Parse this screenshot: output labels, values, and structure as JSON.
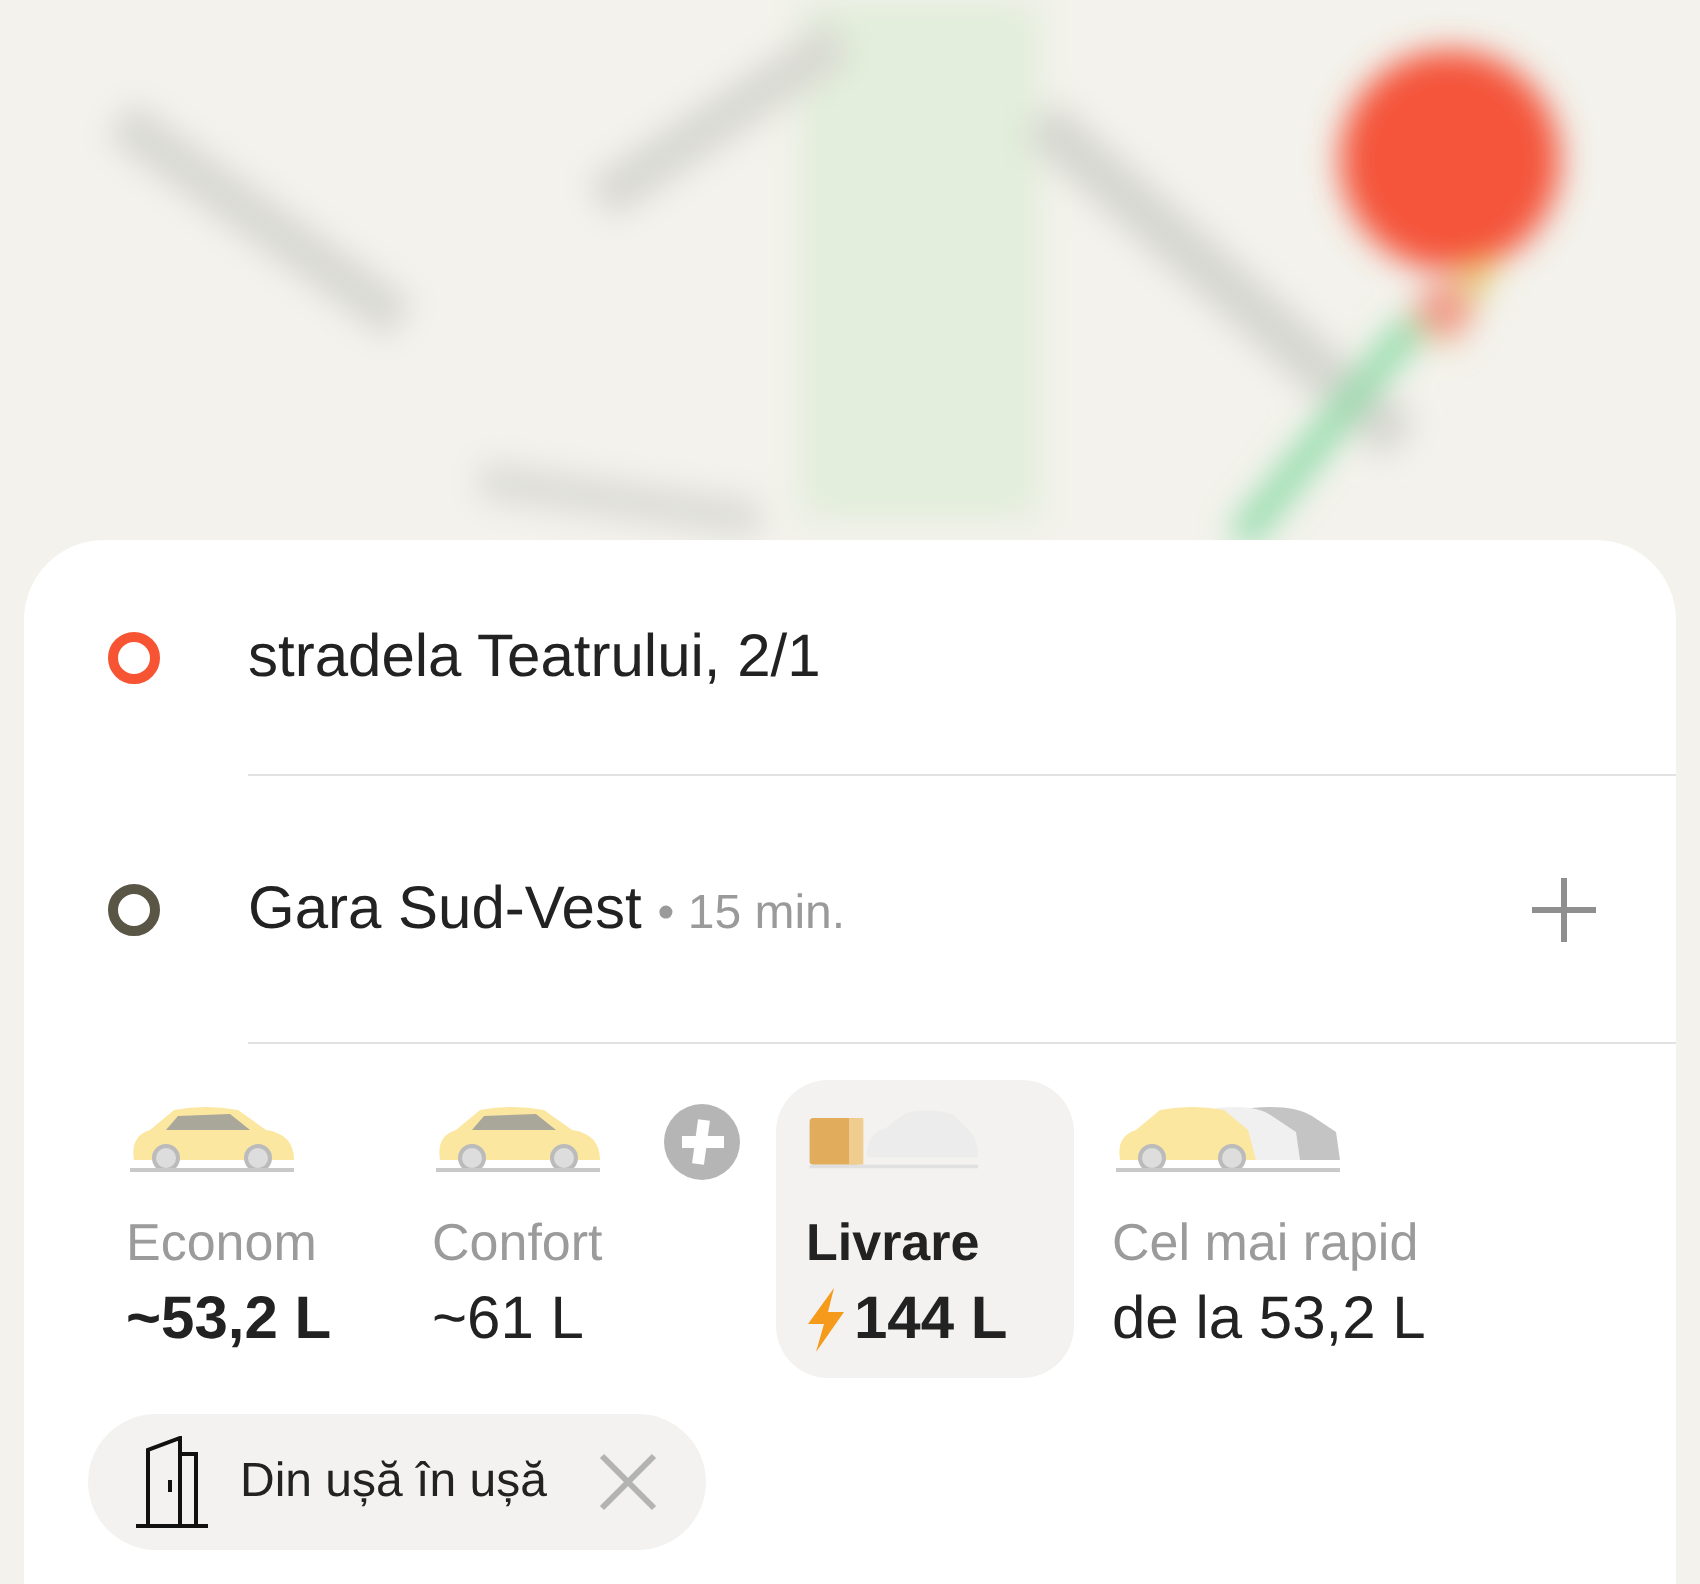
{
  "route": [
    {
      "kind": "origin",
      "address": "stradela Teatrului, 2/1"
    },
    {
      "kind": "destination",
      "address": "Gara Sud-Vest",
      "eta": "• 15 min.",
      "can_add_stop": true
    }
  ],
  "tariffs": [
    {
      "kind": "econom",
      "name": "Econom",
      "price": "~53,2 L",
      "selected": false,
      "price_bold": true,
      "plus_badge": false,
      "surge": false
    },
    {
      "kind": "confort",
      "name": "Confort",
      "price": "~61 L",
      "selected": false,
      "price_bold": false,
      "plus_badge": true,
      "surge": false
    },
    {
      "kind": "delivery",
      "name": "Livrare",
      "price": "144 L",
      "selected": true,
      "price_bold": true,
      "plus_badge": false,
      "surge": true
    },
    {
      "kind": "fastest",
      "name": "Cel mai rapid",
      "price": "de la 53,2 L",
      "selected": false,
      "price_bold": false,
      "plus_badge": false,
      "surge": false
    }
  ],
  "options": [
    {
      "label": "Din ușă în ușă",
      "removable": true
    }
  ]
}
